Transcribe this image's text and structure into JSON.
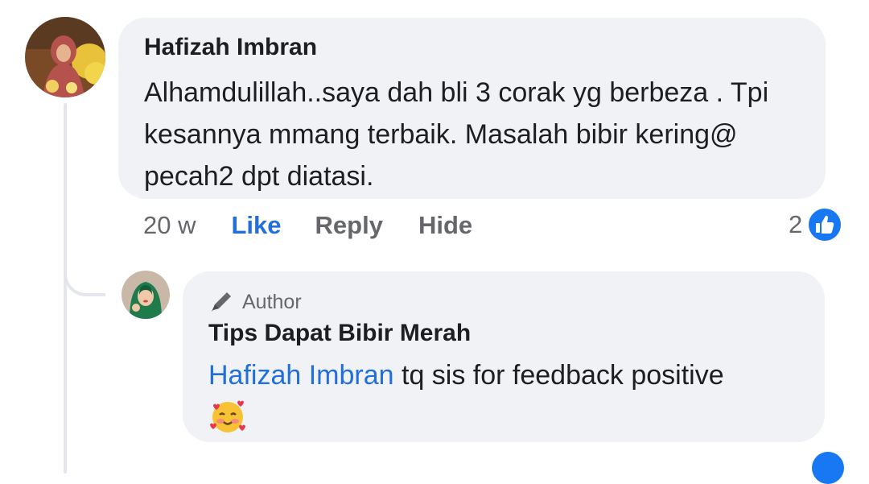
{
  "comment": {
    "author": "Hafizah Imbran",
    "text": "Alhamdulillah..saya dah bli 3 corak yg berbeza . Tpi kesannya mmang terbaik. Masalah bibir kering@ pecah2 dpt diatasi.",
    "time": "20 w",
    "actions": {
      "like": "Like",
      "reply": "Reply",
      "hide": "Hide"
    },
    "reaction_count": "2",
    "reaction_icon": "like-icon",
    "avatar_icon": "avatar-photo"
  },
  "reply": {
    "badge_icon": "pencil-icon",
    "badge_label": "Author",
    "author": "Tips Dapat Bibir Merah",
    "mention": "Hafizah Imbran",
    "text": " tq sis for feedback positive",
    "emoji_icon": "smiling-face-with-hearts-emoji",
    "avatar_icon": "avatar-photo"
  },
  "colors": {
    "link": "#216fdb",
    "like_badge": "#1877f2",
    "bubble": "#f0f2f5",
    "muted": "#65676b"
  }
}
